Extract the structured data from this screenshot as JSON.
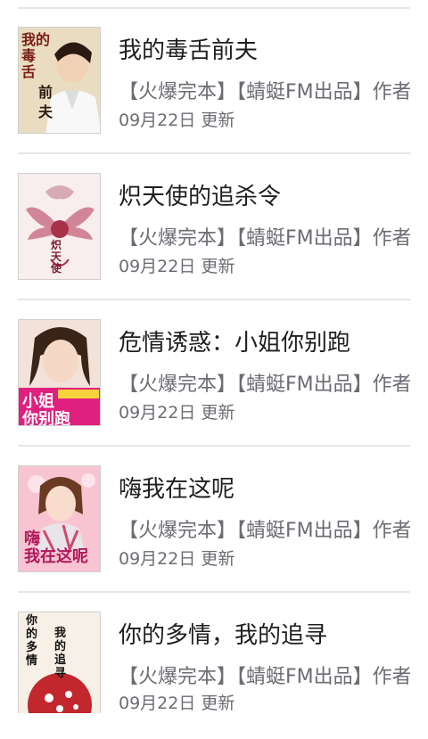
{
  "books": [
    {
      "title": "我的毒舌前夫",
      "subtitle": "【火爆完本】【蜻蜓FM出品】作者...",
      "date": "09月22日 更新",
      "cover_text": "我的毒舌前夫",
      "cover_icon": "book-cover-man",
      "cover_colors": {
        "bg": "#f3ecd8",
        "accent": "#7a4a2a"
      }
    },
    {
      "title": "炽天使的追杀令",
      "subtitle": "【火爆完本】【蜻蜓FM出品】作者...",
      "date": "09月22日 更新",
      "cover_text": "炽天使",
      "cover_icon": "book-cover-wings",
      "cover_colors": {
        "bg": "#f6eaea",
        "accent": "#a8324a"
      }
    },
    {
      "title": "危情诱惑：小姐你别跑",
      "subtitle": "【火爆完本】【蜻蜓FM出品】作者...",
      "date": "09月22日 更新",
      "cover_text": "小姐你别跑",
      "cover_icon": "book-cover-girl",
      "cover_colors": {
        "bg": "#f4e4e0",
        "accent": "#d81b7a"
      }
    },
    {
      "title": "嗨我在这呢",
      "subtitle": "【火爆完本】【蜻蜓FM出品】作者...",
      "date": "09月22日 更新",
      "cover_text": "嗨我在这呢",
      "cover_icon": "book-cover-girl-pink",
      "cover_colors": {
        "bg": "#f7c9d6",
        "accent": "#c2185b"
      }
    },
    {
      "title": "你的多情，我的追寻",
      "subtitle": "【火爆完本】【蜻蜓FM出品】作者...",
      "date": "09月22日 更新",
      "cover_text": "你的多情 我的追寻",
      "cover_icon": "book-cover-red-flower",
      "cover_colors": {
        "bg": "#f5efe4",
        "accent": "#c1272d"
      }
    }
  ]
}
